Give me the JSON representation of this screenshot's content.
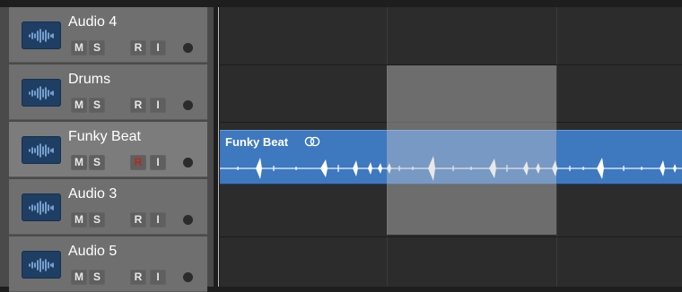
{
  "tracks": [
    {
      "name": "Audio 4",
      "mute": "M",
      "solo": "S",
      "record": "R",
      "input": "I"
    },
    {
      "name": "Drums",
      "mute": "M",
      "solo": "S",
      "record": "R",
      "input": "I"
    },
    {
      "name": "Funky Beat",
      "mute": "M",
      "solo": "S",
      "record": "R",
      "input": "I",
      "record_armed": true
    },
    {
      "name": "Audio 3",
      "mute": "M",
      "solo": "S",
      "record": "R",
      "input": "I"
    },
    {
      "name": "Audio 5",
      "mute": "M",
      "solo": "S",
      "record": "R",
      "input": "I"
    }
  ],
  "region": {
    "title": "Funky Beat",
    "loop_icon": "loop-icon",
    "track": "Funky Beat"
  },
  "icons": {
    "track": "audio-waveform-icon",
    "led": "track-activity-led"
  },
  "colors": {
    "region": "#3e78bf",
    "icon_bg": "#1f3e63",
    "armed": "#b52a1e",
    "header": "#6f6f6f",
    "lane": "#2c2c2c"
  }
}
